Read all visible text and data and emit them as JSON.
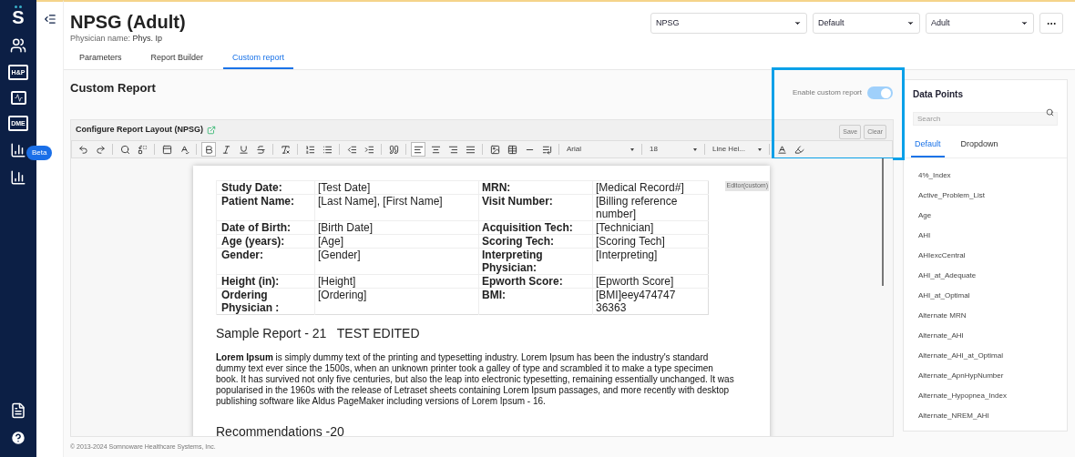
{
  "sidebar": {
    "logo": "S",
    "nav_labels": [
      "H&P",
      "DME"
    ],
    "beta_badge": "Beta"
  },
  "header": {
    "title": "NPSG (Adult)",
    "physician_label": "Physician name:",
    "physician_value": "Phys. Ip",
    "tabs": [
      {
        "label": "Parameters",
        "selected": false
      },
      {
        "label": "Report Builder",
        "selected": false
      },
      {
        "label": "Custom report",
        "selected": true
      }
    ],
    "selects": [
      {
        "value": "NPSG"
      },
      {
        "value": "Default"
      },
      {
        "value": "Adult"
      }
    ]
  },
  "section_title": "Custom Report",
  "enable_toggle": {
    "label": "Enable custom report",
    "on": true
  },
  "editor": {
    "title": "Configure Report Layout (NPSG)",
    "buttons": [
      "Save",
      "Clear"
    ],
    "toolbar_states": {
      "bold": true,
      "align_left": true
    },
    "font": "Arial",
    "size": "18",
    "line_height": "Line Hei...",
    "document": {
      "badge": "Editor(custom)",
      "rows": [
        [
          "Study Date:",
          "[Test Date]",
          "MRN:",
          "[Medical Record#]"
        ],
        [
          "Patient Name:",
          "[Last Name], [First Name]",
          "Visit Number:",
          "[Billing reference number]"
        ],
        [
          "Date of Birth:",
          "[Birth Date]",
          "Acquisition Tech:",
          "[Technician]"
        ],
        [
          "Age (years):",
          "[Age]",
          "Scoring Tech:",
          "[Scoring Tech]"
        ],
        [
          "Gender:",
          "[Gender]",
          "Interpreting Physician:",
          "[Interpreting]"
        ],
        [
          "Height (in):",
          "[Height]",
          "Epworth Score:",
          "[Epworth Score]"
        ],
        [
          "Ordering Physician :",
          "[Ordering]",
          "BMI:",
          "[BMI]eey474747 36363"
        ]
      ],
      "heading": "Sample Report - 21   TEST EDITED",
      "paragraph": "**Lorem Ipsum** is simply dummy text of the printing and typesetting industry. Lorem Ipsum has been the industry's standard dummy text ever since the 1500s, when an unknown printer took a galley of type and scrambled it to make a type specimen book. It has survived not only five centuries, but also the leap into electronic typesetting, remaining essentially unchanged. It was popularised in the 1960s with the release of Letraset sheets containing Lorem Ipsum passages, and more recently with desktop publishing software like Aldus PageMaker including versions of Lorem Ipsum - 16.",
      "heading2": "Recommendations -20"
    }
  },
  "data_points": {
    "title": "Data Points",
    "search": {
      "placeholder": "Search"
    },
    "tabs": [
      {
        "label": "Default",
        "selected": true
      },
      {
        "label": "Dropdown",
        "selected": false
      }
    ],
    "items": [
      "4%_Index",
      "Active_Problem_List",
      "Age",
      "AHI",
      "AHIexcCentral",
      "AHI_at_Adequate",
      "AHI_at_Optimal",
      "Alternate MRN",
      "Alternate_AHI",
      "Alternate_AHI_at_Optimal",
      "Alternate_ApnHypNumber",
      "Alternate_Hypopnea_Index",
      "Alternate_NREM_AHI"
    ]
  },
  "footer": "© 2013-2024 Somnoware Healthcare Systems, Inc."
}
